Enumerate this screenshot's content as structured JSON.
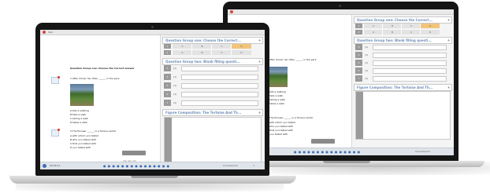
{
  "window": {
    "title": "Test"
  },
  "question": {
    "heading": "Question Group one: Choose the Correct answer",
    "q1": "1.After dinner her often ______ in the park",
    "q1_options": [
      "A.talk a walking",
      "B.take a walk",
      "C.taking a walk",
      "D.takes a walk"
    ],
    "q2": "2.The Pioneer ______ is a famous writer",
    "q2_options": [
      "A.with whom you talked",
      "B.who you talked with",
      "C.that you talked with",
      "D.you talked with"
    ]
  },
  "answer_panel": {
    "group1_title": "Question Group one: Choose the Correct...",
    "group2_title": "Question Group two: Blank filling questi...",
    "group3_title": "Figure Composition: The Tortoise And Th...",
    "choice_rows": [
      {
        "num": "1",
        "options": [
          "A",
          "B",
          "C",
          "D"
        ],
        "selected": 3
      },
      {
        "num": "2",
        "options": [
          "A",
          "B",
          "C",
          "D"
        ],
        "selected": -1
      }
    ],
    "fill_rows": [
      {
        "num": "3",
        "label": "(1)"
      },
      {
        "num": "4",
        "label": "(1)"
      },
      {
        "num": "5",
        "label": "(1)"
      },
      {
        "num": "6",
        "label": "(1)"
      },
      {
        "num": "7",
        "label": "(1)"
      }
    ],
    "collapse_icon": "▲"
  },
  "back_fill_rows": [
    {
      "num": "3",
      "label": "(1)"
    },
    {
      "num": "4",
      "label": "(1)"
    },
    {
      "num": "5",
      "label": "(1)"
    },
    {
      "num": "6",
      "label": "(1)"
    },
    {
      "num": "7",
      "label": "(1)"
    }
  ],
  "taskbar": {
    "time": "00:09:11",
    "status": "Unanswered",
    "status_count": "7",
    "icons": "● ● ● ● ● ● ● ● ● ● ● ● ● ● ●"
  },
  "nav": {
    "prev": "◂",
    "next": "▸",
    "zoom": "+"
  },
  "colors": {
    "accent": "#6f8fb8",
    "selected": "#f2c57c",
    "bezel": "#151515"
  }
}
